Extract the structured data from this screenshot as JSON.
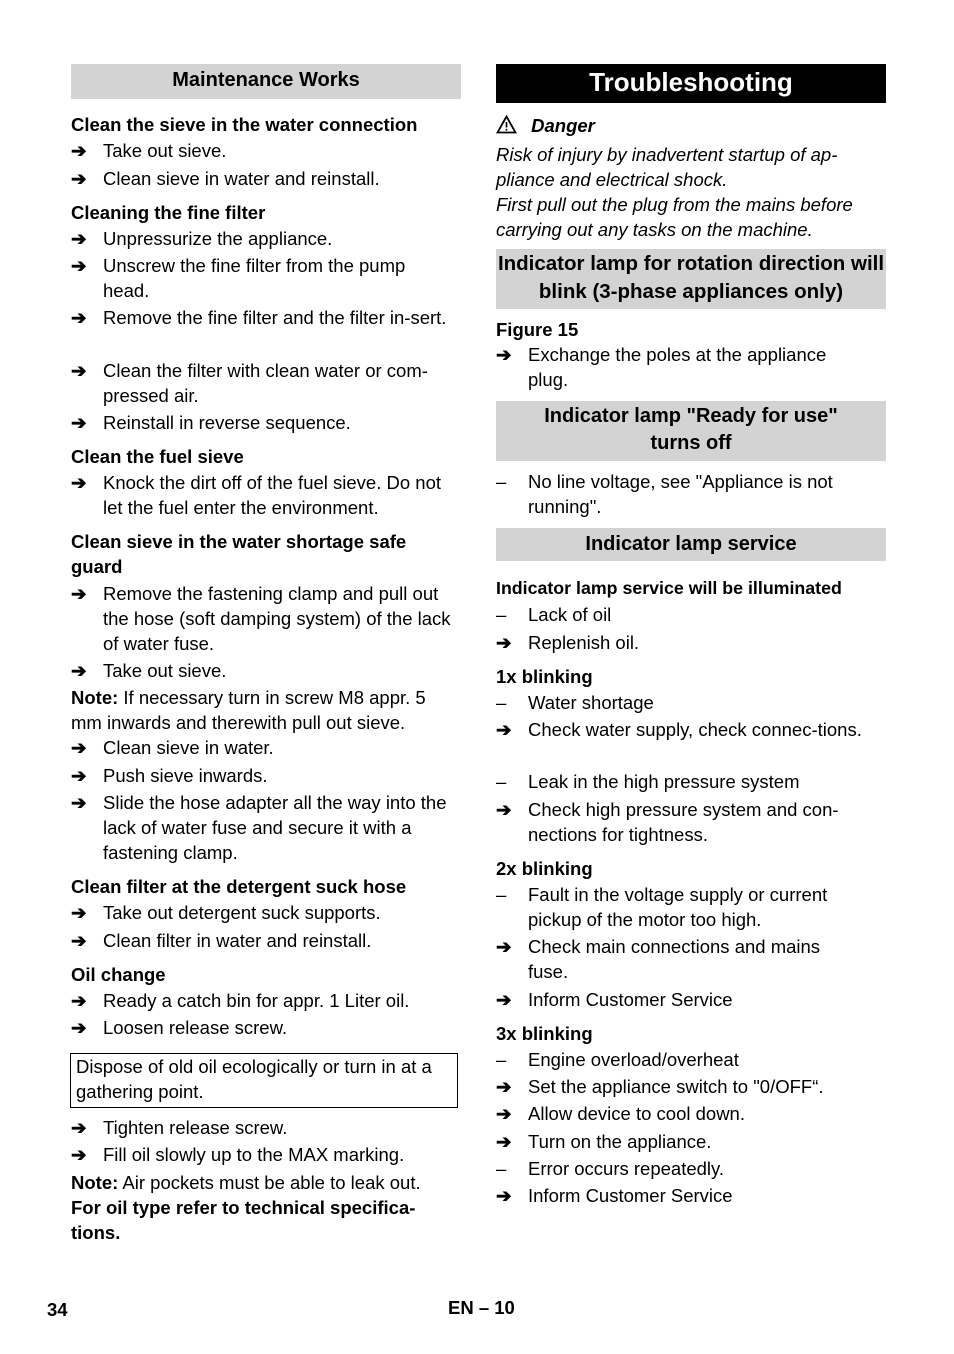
{
  "left": {
    "header": "Maintenance Works",
    "s1": {
      "title": "Clean the sieve in the water connection",
      "items": [
        "Take out sieve.",
        "Clean sieve in water and reinstall."
      ]
    },
    "s2": {
      "title": "Cleaning the fine filter",
      "items": [
        "Unpressurize the appliance.",
        "Unscrew the fine filter from the pump head.",
        "Remove the fine filter and the filter in-sert.",
        "Clean the filter with clean water or com-pressed air.",
        "Reinstall in reverse sequence."
      ]
    },
    "s3": {
      "title": "Clean the fuel sieve",
      "items": [
        "Knock the dirt off of the fuel sieve. Do not let the fuel enter the environment."
      ]
    },
    "s4": {
      "title": "Clean sieve in the water shortage safe guard",
      "items": [
        "Remove the fastening clamp and pull out the hose (soft damping system) of the lack of water fuse.",
        "Take out sieve."
      ],
      "note_label": "Note:",
      "note_text": " If necessary turn in screw M8 appr. 5 mm inwards and therewith pull out sieve.",
      "items2": [
        "Clean sieve in water.",
        "Push sieve inwards.",
        "Slide the hose adapter all the way into the lack of water fuse and secure it with a fastening clamp."
      ]
    },
    "s5": {
      "title": "Clean filter at the detergent suck hose",
      "items": [
        "Take out detergent suck supports.",
        "Clean filter in water and reinstall."
      ]
    },
    "s6": {
      "title": "Oil change",
      "items": [
        "Ready a catch bin for appr. 1 Liter oil.",
        "Loosen release screw."
      ],
      "box": "Dispose of old oil ecologically or turn in at a gathering point.",
      "items2": [
        "Tighten release screw.",
        "Fill oil slowly up to the MAX marking."
      ],
      "note_label": "Note:",
      "note_text": " Air pockets must be able to leak out.",
      "bold_note": "For oil type refer to technical specifica-tions."
    }
  },
  "right": {
    "header": "Troubleshooting",
    "danger": {
      "icon": "warning-triangle-icon",
      "label": "Danger",
      "text1": "Risk of injury by inadvertent startup of ap-pliance and electrical shock.",
      "text2": "First pull out the plug from the mains before carrying out any tasks on the machine."
    },
    "rot": {
      "header": "Indicator lamp for rotation direction will blink (3-phase appliances only)",
      "figure": "Figure 15",
      "items": [
        "Exchange the poles at the appliance plug."
      ]
    },
    "ready": {
      "header": "Indicator lamp \"Ready for use\" turns off",
      "items": [
        "No line voltage, see \"Appliance is not running\"."
      ]
    },
    "service": {
      "header": "Indicator lamp service",
      "sub": "Indicator lamp service will be illuminated",
      "items": [
        "Lack of oil",
        "Replenish oil."
      ],
      "b1": {
        "title": "1x blinking",
        "items": [
          "Water shortage",
          "Check water supply, check connec-tions.",
          "Leak in the high pressure system",
          "Check high pressure system and con-nections for tightness."
        ]
      },
      "b2": {
        "title": "2x blinking",
        "items": [
          "Fault in the voltage supply or current pickup of the motor too high.",
          "Check main connections and mains fuse.",
          "Inform Customer Service"
        ]
      },
      "b3": {
        "title": "3x blinking",
        "items": [
          "Engine overload/overheat",
          "Set the appliance switch to \"0/OFF“.",
          "Allow device to cool down.",
          "Turn on the appliance.",
          "Error occurs repeatedly.",
          "Inform Customer Service"
        ]
      }
    }
  },
  "markers": {
    "arrow": "➔",
    "dash": "–"
  },
  "footer": {
    "page": "34",
    "lang": "EN – 10"
  }
}
